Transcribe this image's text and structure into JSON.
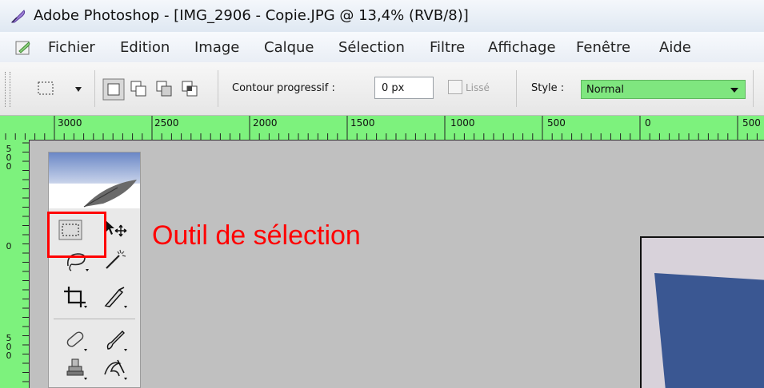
{
  "window": {
    "title": "Adobe Photoshop - [IMG_2906 - Copie.JPG @ 13,4% (RVB/8)]"
  },
  "menu": [
    "Fichier",
    "Edition",
    "Image",
    "Calque",
    "Sélection",
    "Filtre",
    "Affichage",
    "Fenêtre",
    "Aide"
  ],
  "options": {
    "feather_label": "Contour progressif :",
    "feather_value": "0 px",
    "antialias_label": "Lissé",
    "style_label": "Style :",
    "style_value": "Normal"
  },
  "ruler": {
    "horizontal_labels": [
      "3000",
      "2500",
      "2000",
      "1500",
      "1000",
      "500",
      "0",
      "500"
    ],
    "vertical_labels_1": [
      "5",
      "0",
      "0"
    ],
    "vertical_labels_2": [
      "0"
    ],
    "vertical_labels_3": [
      "5",
      "0",
      "0"
    ]
  },
  "annotation": {
    "text": "Outil de sélection",
    "color": "#ff0000"
  },
  "icons": {
    "app": "photoshop-feather-icon",
    "marquee": "rectangular-marquee-icon",
    "move": "move-icon",
    "lasso": "lasso-icon",
    "wand": "magic-wand-icon",
    "crop": "crop-icon",
    "slice": "slice-icon",
    "healing": "healing-brush-icon",
    "brush": "brush-icon",
    "stamp": "clone-stamp-icon",
    "history_brush": "history-brush-icon"
  },
  "colors": {
    "ruler": "#7df27d",
    "style_highlight": "#7fe67f",
    "annotation": "#ff0000",
    "canvas_blue": "#3a5792"
  }
}
